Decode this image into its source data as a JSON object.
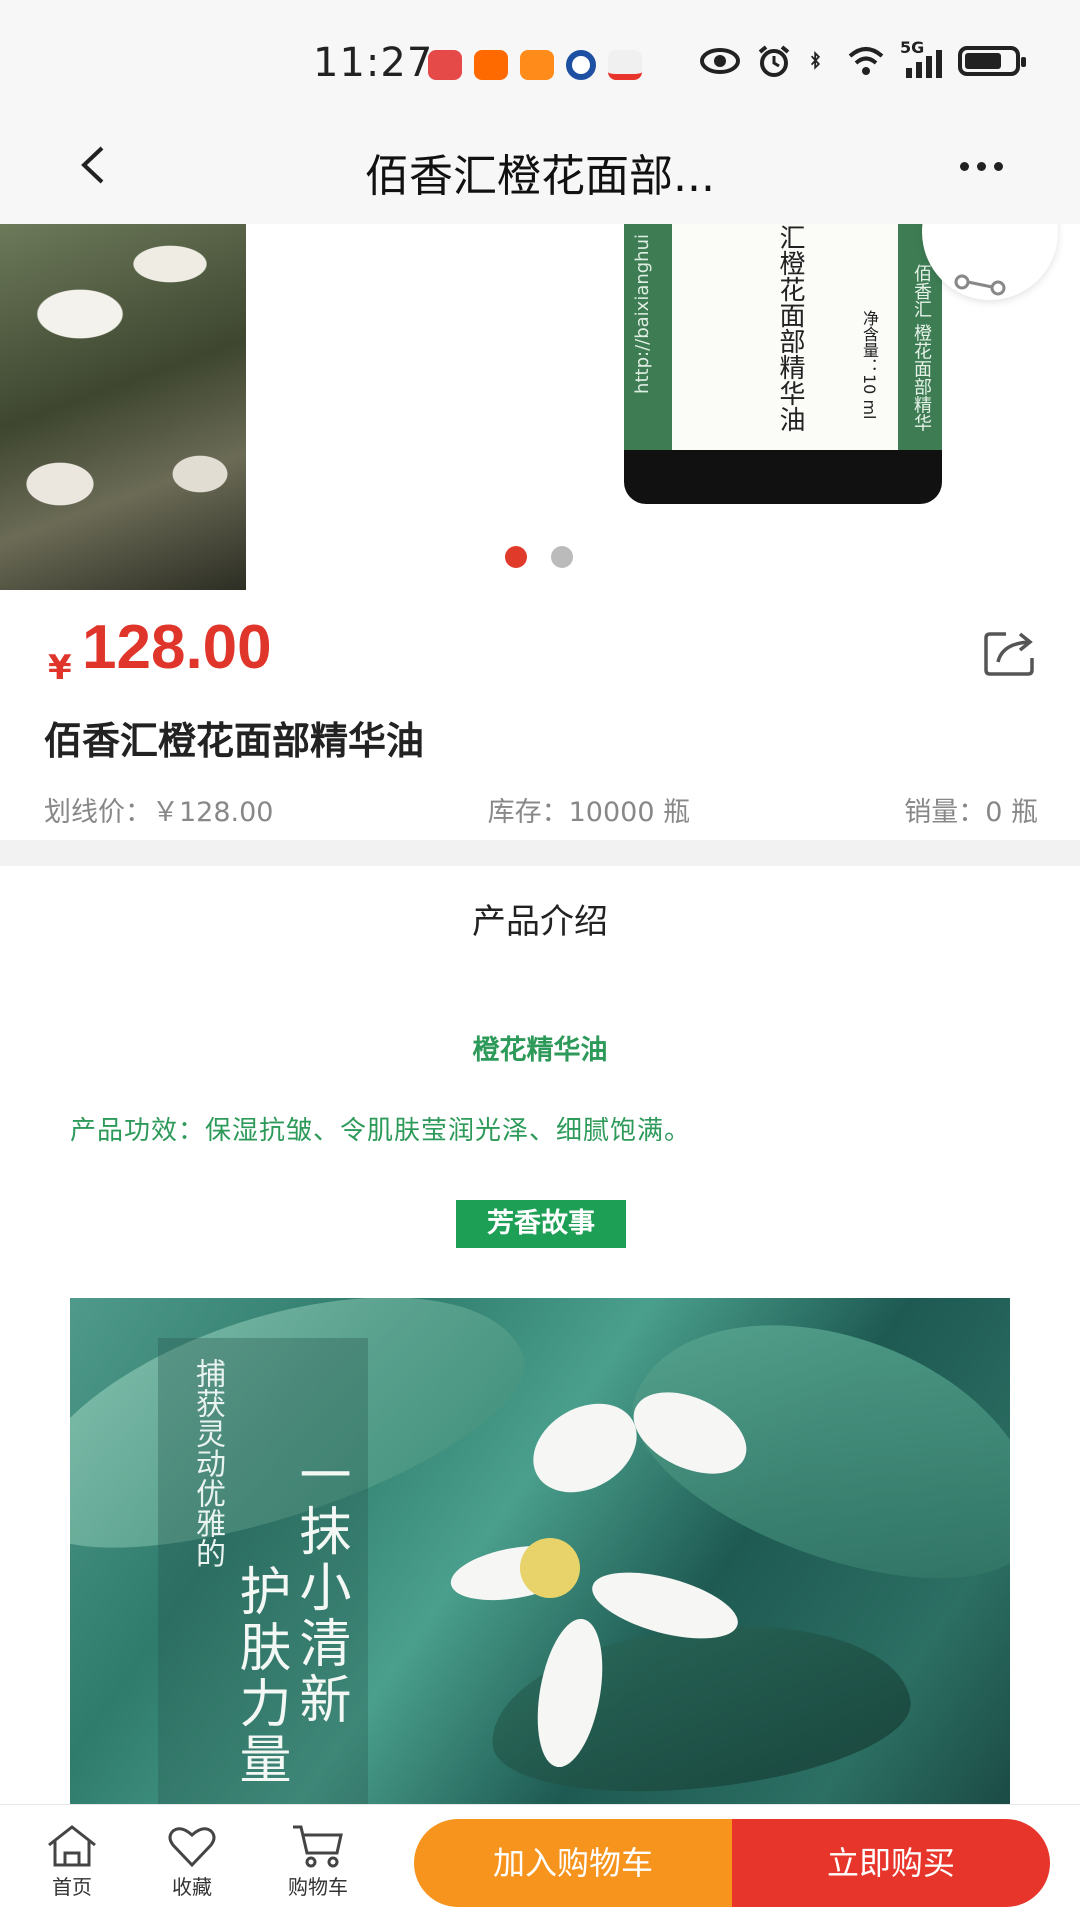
{
  "status_bar": {
    "time": "11:27",
    "network_label": "5G",
    "app_icons": [
      {
        "name": "huawei-app-icon",
        "color": "#e64a48"
      },
      {
        "name": "taobao-app-icon",
        "color": "#ff6a00"
      },
      {
        "name": "taobao-flash-app-icon",
        "color": "#ff8c1a"
      },
      {
        "name": "bank-app-icon",
        "color": "#1d4fa3"
      },
      {
        "name": "mobile-carrier-app-icon",
        "color": "#e8352b"
      }
    ],
    "indicator_icons": [
      "eye-icon",
      "alarm-icon",
      "bluetooth-icon",
      "wifi-icon",
      "signal-icon",
      "battery-icon"
    ]
  },
  "nav": {
    "title": "佰香汇橙花面部...",
    "back_icon": "chevron-left-icon",
    "more_icon": "more-dots-icon"
  },
  "carousel": {
    "slide_count": 2,
    "active_index": 0,
    "bottle_name": "汇橙花面部精华油",
    "bottle_net": "净含量：10 ml",
    "bottle_url": "http://baixianghui",
    "bottle_side": "佰香汇 橙花面部精华"
  },
  "product": {
    "currency": "¥",
    "price": "128.00",
    "title": "佰香汇橙花面部精华油",
    "list_price": "划线价：￥128.00",
    "stock": "库存：10000 瓶",
    "sales": "销量：0 瓶",
    "share_icon": "share-icon"
  },
  "intro": {
    "heading": "产品介绍",
    "subtitle": "橙花精华油",
    "effect": "产品功效：保湿抗皱、令肌肤莹润光泽、细腻饱满。",
    "story_badge": "芳香故事",
    "story_small": "捕获灵动优雅的",
    "story_big1": "护肤力量",
    "story_big2": "一抹小清新"
  },
  "bottom_bar": {
    "tabs": [
      {
        "label": "首页",
        "icon": "home-icon"
      },
      {
        "label": "收藏",
        "icon": "heart-icon"
      },
      {
        "label": "购物车",
        "icon": "cart-icon"
      }
    ],
    "add_to_cart": "加入购物车",
    "buy_now": "立即购买",
    "colors": {
      "cart": "#f7941d",
      "buy": "#e8352b",
      "price": "#e0352a",
      "green": "#1d9f55"
    }
  }
}
